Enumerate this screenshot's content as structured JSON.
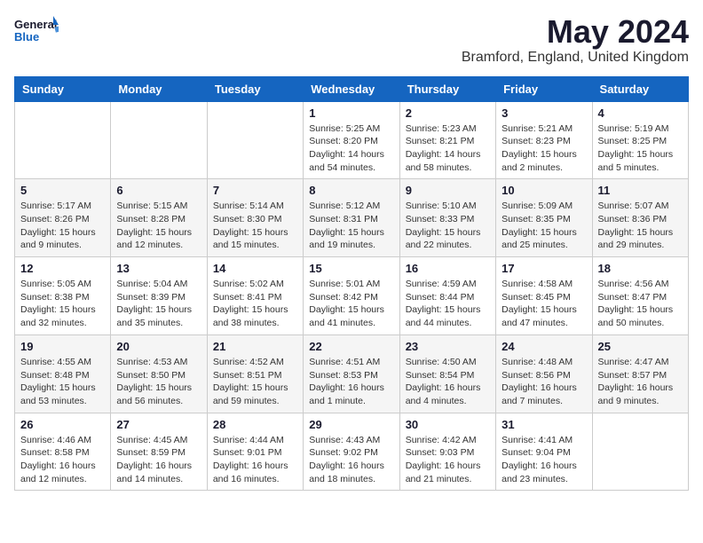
{
  "header": {
    "logo_general": "General",
    "logo_blue": "Blue",
    "month_title": "May 2024",
    "location": "Bramford, England, United Kingdom"
  },
  "days_of_week": [
    "Sunday",
    "Monday",
    "Tuesday",
    "Wednesday",
    "Thursday",
    "Friday",
    "Saturday"
  ],
  "weeks": [
    [
      {
        "day": "",
        "info": ""
      },
      {
        "day": "",
        "info": ""
      },
      {
        "day": "",
        "info": ""
      },
      {
        "day": "1",
        "info": "Sunrise: 5:25 AM\nSunset: 8:20 PM\nDaylight: 14 hours\nand 54 minutes."
      },
      {
        "day": "2",
        "info": "Sunrise: 5:23 AM\nSunset: 8:21 PM\nDaylight: 14 hours\nand 58 minutes."
      },
      {
        "day": "3",
        "info": "Sunrise: 5:21 AM\nSunset: 8:23 PM\nDaylight: 15 hours\nand 2 minutes."
      },
      {
        "day": "4",
        "info": "Sunrise: 5:19 AM\nSunset: 8:25 PM\nDaylight: 15 hours\nand 5 minutes."
      }
    ],
    [
      {
        "day": "5",
        "info": "Sunrise: 5:17 AM\nSunset: 8:26 PM\nDaylight: 15 hours\nand 9 minutes."
      },
      {
        "day": "6",
        "info": "Sunrise: 5:15 AM\nSunset: 8:28 PM\nDaylight: 15 hours\nand 12 minutes."
      },
      {
        "day": "7",
        "info": "Sunrise: 5:14 AM\nSunset: 8:30 PM\nDaylight: 15 hours\nand 15 minutes."
      },
      {
        "day": "8",
        "info": "Sunrise: 5:12 AM\nSunset: 8:31 PM\nDaylight: 15 hours\nand 19 minutes."
      },
      {
        "day": "9",
        "info": "Sunrise: 5:10 AM\nSunset: 8:33 PM\nDaylight: 15 hours\nand 22 minutes."
      },
      {
        "day": "10",
        "info": "Sunrise: 5:09 AM\nSunset: 8:35 PM\nDaylight: 15 hours\nand 25 minutes."
      },
      {
        "day": "11",
        "info": "Sunrise: 5:07 AM\nSunset: 8:36 PM\nDaylight: 15 hours\nand 29 minutes."
      }
    ],
    [
      {
        "day": "12",
        "info": "Sunrise: 5:05 AM\nSunset: 8:38 PM\nDaylight: 15 hours\nand 32 minutes."
      },
      {
        "day": "13",
        "info": "Sunrise: 5:04 AM\nSunset: 8:39 PM\nDaylight: 15 hours\nand 35 minutes."
      },
      {
        "day": "14",
        "info": "Sunrise: 5:02 AM\nSunset: 8:41 PM\nDaylight: 15 hours\nand 38 minutes."
      },
      {
        "day": "15",
        "info": "Sunrise: 5:01 AM\nSunset: 8:42 PM\nDaylight: 15 hours\nand 41 minutes."
      },
      {
        "day": "16",
        "info": "Sunrise: 4:59 AM\nSunset: 8:44 PM\nDaylight: 15 hours\nand 44 minutes."
      },
      {
        "day": "17",
        "info": "Sunrise: 4:58 AM\nSunset: 8:45 PM\nDaylight: 15 hours\nand 47 minutes."
      },
      {
        "day": "18",
        "info": "Sunrise: 4:56 AM\nSunset: 8:47 PM\nDaylight: 15 hours\nand 50 minutes."
      }
    ],
    [
      {
        "day": "19",
        "info": "Sunrise: 4:55 AM\nSunset: 8:48 PM\nDaylight: 15 hours\nand 53 minutes."
      },
      {
        "day": "20",
        "info": "Sunrise: 4:53 AM\nSunset: 8:50 PM\nDaylight: 15 hours\nand 56 minutes."
      },
      {
        "day": "21",
        "info": "Sunrise: 4:52 AM\nSunset: 8:51 PM\nDaylight: 15 hours\nand 59 minutes."
      },
      {
        "day": "22",
        "info": "Sunrise: 4:51 AM\nSunset: 8:53 PM\nDaylight: 16 hours\nand 1 minute."
      },
      {
        "day": "23",
        "info": "Sunrise: 4:50 AM\nSunset: 8:54 PM\nDaylight: 16 hours\nand 4 minutes."
      },
      {
        "day": "24",
        "info": "Sunrise: 4:48 AM\nSunset: 8:56 PM\nDaylight: 16 hours\nand 7 minutes."
      },
      {
        "day": "25",
        "info": "Sunrise: 4:47 AM\nSunset: 8:57 PM\nDaylight: 16 hours\nand 9 minutes."
      }
    ],
    [
      {
        "day": "26",
        "info": "Sunrise: 4:46 AM\nSunset: 8:58 PM\nDaylight: 16 hours\nand 12 minutes."
      },
      {
        "day": "27",
        "info": "Sunrise: 4:45 AM\nSunset: 8:59 PM\nDaylight: 16 hours\nand 14 minutes."
      },
      {
        "day": "28",
        "info": "Sunrise: 4:44 AM\nSunset: 9:01 PM\nDaylight: 16 hours\nand 16 minutes."
      },
      {
        "day": "29",
        "info": "Sunrise: 4:43 AM\nSunset: 9:02 PM\nDaylight: 16 hours\nand 18 minutes."
      },
      {
        "day": "30",
        "info": "Sunrise: 4:42 AM\nSunset: 9:03 PM\nDaylight: 16 hours\nand 21 minutes."
      },
      {
        "day": "31",
        "info": "Sunrise: 4:41 AM\nSunset: 9:04 PM\nDaylight: 16 hours\nand 23 minutes."
      },
      {
        "day": "",
        "info": ""
      }
    ]
  ]
}
